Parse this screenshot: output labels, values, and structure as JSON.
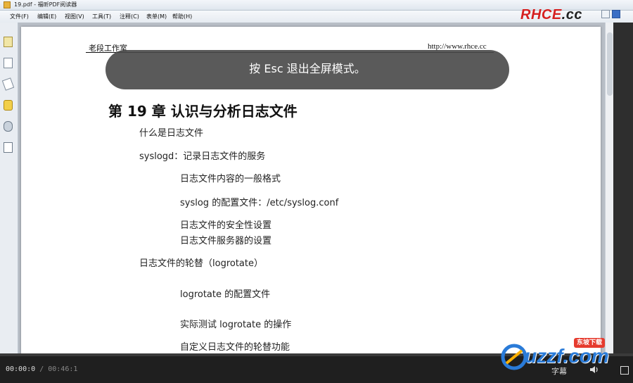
{
  "window": {
    "title": "19.pdf - 福昕PDF阅读器"
  },
  "menu": [
    "文件(F)",
    "编辑(E)",
    "视图(V)",
    "工具(T)",
    "注释(C)",
    "表单(M)",
    "帮助(H)"
  ],
  "brand": {
    "main": "RHCE",
    "suffix": ".cc"
  },
  "document": {
    "header_left": "老段工作室",
    "header_right": "http://www.rhce.cc",
    "chapter_title": "第 19 章  认识与分析日志文件",
    "lines": [
      "什么是日志文件",
      "syslogd：记录日志文件的服务",
      "日志文件内容的一般格式",
      "syslog 的配置文件：/etc/syslog.conf",
      "日志文件的安全性设置",
      "日志文件服务器的设置",
      "日志文件的轮替（logrotate）",
      "logrotate 的配置文件",
      "实际测试 logrotate 的操作",
      "自定义日志文件的轮替功能"
    ]
  },
  "overlay": {
    "message": "按 Esc 退出全屏模式。"
  },
  "player": {
    "current_time": "00:00:0",
    "separator": "/",
    "duration": "00:46:1",
    "progress_fraction": 0.0,
    "subtitle_label": "字幕"
  },
  "watermark": {
    "text": "uzzf.com",
    "badge": "东坡下载"
  },
  "colors": {
    "brand_red": "#d62020",
    "overlay_bg": "#484848",
    "watermark_blue": "#2a7bd8"
  }
}
